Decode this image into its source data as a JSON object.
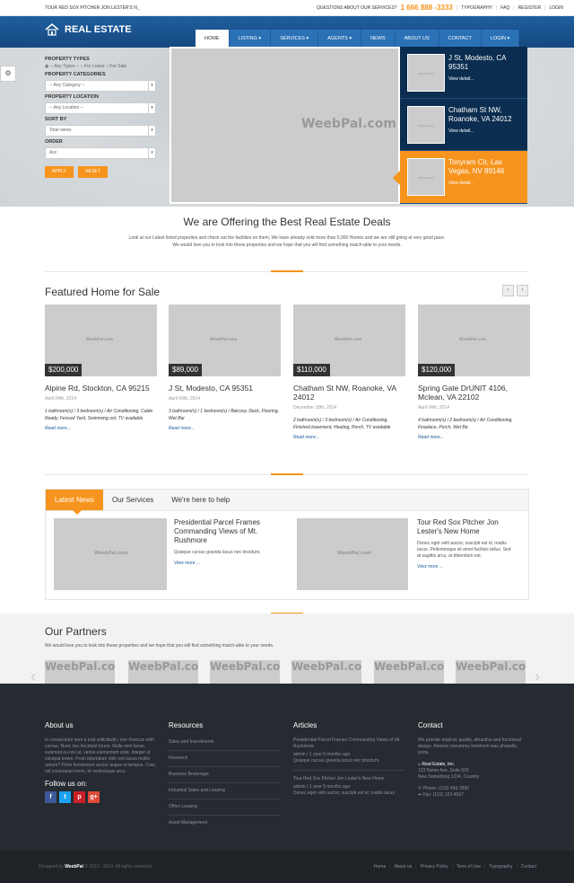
{
  "topbar": {
    "ticker": "TOUR RED SOX PITCHER JON LESTER'S N_",
    "question": "QUESTIONS ABOUT OUR SERVICES?",
    "phone": "1 666 888 -3333",
    "links": [
      "TYPOGRAPHY",
      "FAQ",
      "REGISTER",
      "LOGIN"
    ]
  },
  "brand": {
    "name": "REAL ESTATE"
  },
  "nav": [
    {
      "label": "HOME",
      "active": true
    },
    {
      "label": "LISTING ▾"
    },
    {
      "label": "SERVICES ▾"
    },
    {
      "label": "AGENTS ▾"
    },
    {
      "label": "NEWS"
    },
    {
      "label": "ABOUT US"
    },
    {
      "label": "CONTACT"
    },
    {
      "label": "LOGIN ▾"
    }
  ],
  "search": {
    "types_label": "PROPERTY TYPES",
    "types_options": "◉ -- Any Types --  ○ For Lease  ○ For Sale",
    "categories_label": "PROPERTY CATEGORIES",
    "category_value": "-- Any Category --",
    "location_label": "PROPERTY LOCATION",
    "location_value": "-- Any Location --",
    "sort_label": "SORT BY",
    "sort_value": "Total views",
    "order_label": "ORDER",
    "order_value": "Asc",
    "apply": "APPLY",
    "reset": "RESET"
  },
  "hero": {
    "watermark": "WeebPal.com",
    "featured": [
      {
        "title": "J St, Modesto, CA 95351",
        "view": "View detail...",
        "thumb": "WeebPal.com"
      },
      {
        "title": "Chatham St NW, Roanoke, VA 24012",
        "view": "View detail...",
        "thumb": "WeebPal.com"
      },
      {
        "title": "Tonyram Cir, Las Vegas, NV 89146",
        "view": "View detail...",
        "thumb": "WeebPal.com"
      }
    ]
  },
  "offer": {
    "title": "We are Offering the Best Real Estate Deals",
    "line1": "Look at our Latest listed properties and check out the facilities on them, We have already sold more than 5,000 Homes and we are still going at very good pace.",
    "line2": "We would love you to look into these properties and we hope that you will find something match-able to your needs."
  },
  "featured": {
    "title": "Featured Home for Sale",
    "prev": "‹",
    "next": "›",
    "cards": [
      {
        "price": "$200,000",
        "title": "Alpine Rd, Stockton, CA 95215",
        "date": "April 04th, 2014",
        "desc": "1 bathroom(s) / 3 bedroom(s) / Air Conditioning, Cable Ready, Fenced Yard, Swimming ool, TV available",
        "more": "Read more...",
        "wm": "WeebPal.com"
      },
      {
        "price": "$89,000",
        "title": "J St, Modesto, CA 95351",
        "date": "April 04th, 2014",
        "desc": "3 bathroom(s) / 1 bedroom(s) / Balcony, Deck, Flooring, Wet Bar",
        "more": "Read more...",
        "wm": "WeebPal.com"
      },
      {
        "price": "$110,000",
        "title": "Chatham St NW, Roanoke, VA 24012",
        "date": "December 18th, 2014",
        "desc": "2 bathroom(s) / 3 bedroom(s) / Air Conditioning, Finished basement, Heating, Porch, TV available",
        "more": "Read more...",
        "wm": "WeebPal.com"
      },
      {
        "price": "$120,000",
        "title": "Spring Gate DrUNIT 4106, Mclean, VA 22102",
        "date": "April 04th, 2014",
        "desc": "4 bathroom(s) / 2 bedroom(s) / Air Conditioning, Fireplace, Porch, Wet Ba",
        "more": "Read more...",
        "wm": "WeebPal.com"
      }
    ]
  },
  "tabs": {
    "items": [
      "Latest News",
      "Our Services",
      "We're here to help"
    ],
    "news": [
      {
        "title": "Presidential Parcel Frames Commanding Views of Mt. Rushmore",
        "desc": "Quisque cursus gravida lacus nec tincidunt.",
        "more": "View more ...",
        "wm": "WeebPal.com"
      },
      {
        "title": "Tour Red Sox Pitcher Jon Lester's New Home",
        "desc": "Donec eget velit auctor, suscipit est id, mattis lacus. Pellentesque sit amet facilisis tellus. Sed at sagittis arcu, at bibendum est.",
        "more": "View more ...",
        "wm": "WeebPal.com"
      }
    ]
  },
  "partners": {
    "title": "Our Partners",
    "subtitle": "We would love you to look into these properties and we hope that you will find something match-able to your needs.",
    "logo": "WeebPal.com",
    "prev": "‹",
    "next": "›"
  },
  "footer": {
    "about": {
      "title": "About us",
      "text": "In consectetur sem a erat sollicitudin, non rhoncus nibh cursus. Nunc nec tincidunt lorem. Nulla sem lacus, euismod eu nisi at, varius elementum ante. Integer ut volutpat lorem. Proin bibendum nibh non lacus mollis rutrum? Proin fermentum auctor augue et tempus. Cras vel consequat lorem, et scelerisque arcu.",
      "follow": "Follow us on:"
    },
    "resources": {
      "title": "Resources",
      "items": [
        "Sales and Investments",
        "Research",
        "Business Brokerage",
        "Industrial Sales and Leasing",
        "Office Leasing",
        "Asset Management"
      ]
    },
    "articles": {
      "title": "Articles",
      "a1_title": "Presidential Parcel Frames Commanding Views of Mt. Rushmore",
      "a1_meta": "admin / 1 year 5 months ago",
      "a1_desc": "Quisque cursus gravida lacus nec tincidunt.",
      "a2_title": "Tour Red Sox Pitcher Jon Lester's New Home",
      "a2_meta": "admin / 1 year 5 months ago",
      "a2_desc": "Donec eget velit auctor, suscipit est id, mattis lacus."
    },
    "contact": {
      "title": "Contact",
      "text": "We provide original, quality, attractive and functional design. Aenean nonummy hendrerit mau phasellu porta.",
      "company": "Real Estate, Inc.",
      "addr1": "123 Name Ave, Suite 600",
      "addr2": "New Something 1234, Country",
      "phone": "Phone: (123) 456-7890",
      "fax": "Fax: (123) 123-4567"
    },
    "bottom": {
      "designed": "Designed by",
      "brand": "WeebPal",
      "rights": "© 2013 - 2014. All rights reserved.",
      "links": [
        "Home",
        "About us",
        "Privacy Policy",
        "Term of Use",
        "Typography",
        "Contact"
      ]
    }
  },
  "colors": {
    "accent": "#f7941d",
    "brand": "#1d5a9a",
    "footer": "#262b31"
  }
}
